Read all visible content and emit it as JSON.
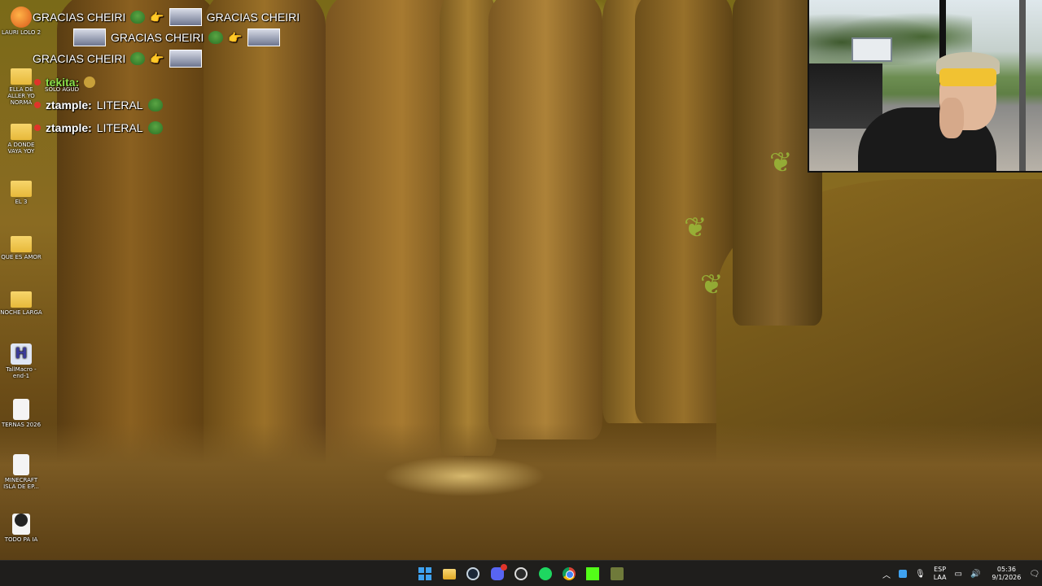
{
  "chat": {
    "lines": [
      {
        "user": "",
        "text": "GRACIAS CHEIRI",
        "repeat": "GRACIAS CHEIRI"
      },
      {
        "user": "",
        "text": "GRACIAS CHEIRI"
      },
      {
        "user": "",
        "text": "GRACIAS CHEIRI"
      },
      {
        "user": "tekita:",
        "text": ""
      },
      {
        "user": "ztample:",
        "text": "LITERAL"
      },
      {
        "user": "ztample:",
        "text": "LITERAL"
      }
    ],
    "user_color_tekita": "#8be04a"
  },
  "desktop_icons": [
    {
      "label": "LAURI LOLO 2",
      "icon": "app-icon"
    },
    {
      "label": "ELLA DE ALLER YO NORMA",
      "icon": "folder-icon"
    },
    {
      "label": "SOLO AGUD",
      "icon": "folder-icon"
    },
    {
      "label": "A DONDE VAYA YOY",
      "icon": "folder-icon"
    },
    {
      "label": "EL 3",
      "icon": "folder-icon"
    },
    {
      "label": "QUE ES AMOR",
      "icon": "folder-icon"
    },
    {
      "label": "NOCHE LARGA",
      "icon": "folder-icon"
    },
    {
      "label": "TallMacro - end-1",
      "icon": "h-app-icon"
    },
    {
      "label": "TERNAS 2026",
      "icon": "document-icon"
    },
    {
      "label": "MINECRAFT ISLA DE EP...",
      "icon": "document-icon"
    },
    {
      "label": "TODO PA IA",
      "icon": "video-icon"
    }
  ],
  "taskbar": {
    "apps": [
      "windows-start-icon",
      "file-explorer-icon",
      "steam-icon",
      "discord-icon",
      "obs-icon",
      "spotify-icon",
      "chrome-icon",
      "kick-icon",
      "app-icon"
    ],
    "tray": {
      "lang_top": "ESP",
      "lang_bottom": "LAA",
      "time": "05:36",
      "date": "9/1/2026"
    }
  }
}
